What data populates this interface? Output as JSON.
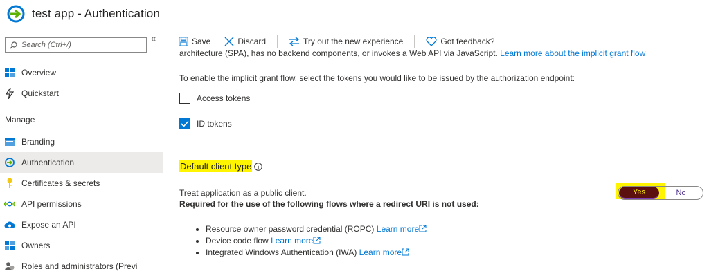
{
  "app": {
    "title": "test app - Authentication",
    "accent_color": "#0078d4"
  },
  "sidebar": {
    "search_placeholder": "Search (Ctrl+/)",
    "collapse_glyph": "«",
    "top_items": [
      {
        "label": "Overview",
        "icon": "grid-icon"
      },
      {
        "label": "Quickstart",
        "icon": "lightning-icon"
      }
    ],
    "section_label": "Manage",
    "manage_items": [
      {
        "label": "Branding",
        "icon": "branding-icon"
      },
      {
        "label": "Authentication",
        "icon": "authentication-icon",
        "active": true
      },
      {
        "label": "Certificates & secrets",
        "icon": "key-icon"
      },
      {
        "label": "API permissions",
        "icon": "api-permissions-icon"
      },
      {
        "label": "Expose an API",
        "icon": "cloud-icon"
      },
      {
        "label": "Owners",
        "icon": "owners-icon"
      },
      {
        "label": "Roles and administrators (Previ",
        "icon": "roles-icon"
      }
    ]
  },
  "toolbar": {
    "save_label": "Save",
    "discard_label": "Discard",
    "try_label": "Try out the new experience",
    "feedback_label": "Got feedback?"
  },
  "content": {
    "cut_text": "architecture (SPA), has no backend components, or invokes a Web API via JavaScript.",
    "cut_link": "Learn more about the implicit grant flow",
    "instructions": "To enable the implicit grant flow, select the tokens you would like to be issued by the authorization endpoint:",
    "checkboxes": [
      {
        "label": "Access tokens",
        "checked": false
      },
      {
        "label": "ID tokens",
        "checked": true
      }
    ],
    "section_title": "Default client type",
    "treat_label": "Treat application as a public client.",
    "required_label": "Required for the use of the following flows where a redirect URI is not used:",
    "flows": [
      {
        "text": "Resource owner password credential (ROPC)",
        "link": "Learn more"
      },
      {
        "text": "Device code flow",
        "link": "Learn more"
      },
      {
        "text": "Integrated Windows Authentication (IWA)",
        "link": "Learn more"
      }
    ],
    "toggle": {
      "yes_label": "Yes",
      "no_label": "No",
      "selected": "Yes"
    }
  }
}
